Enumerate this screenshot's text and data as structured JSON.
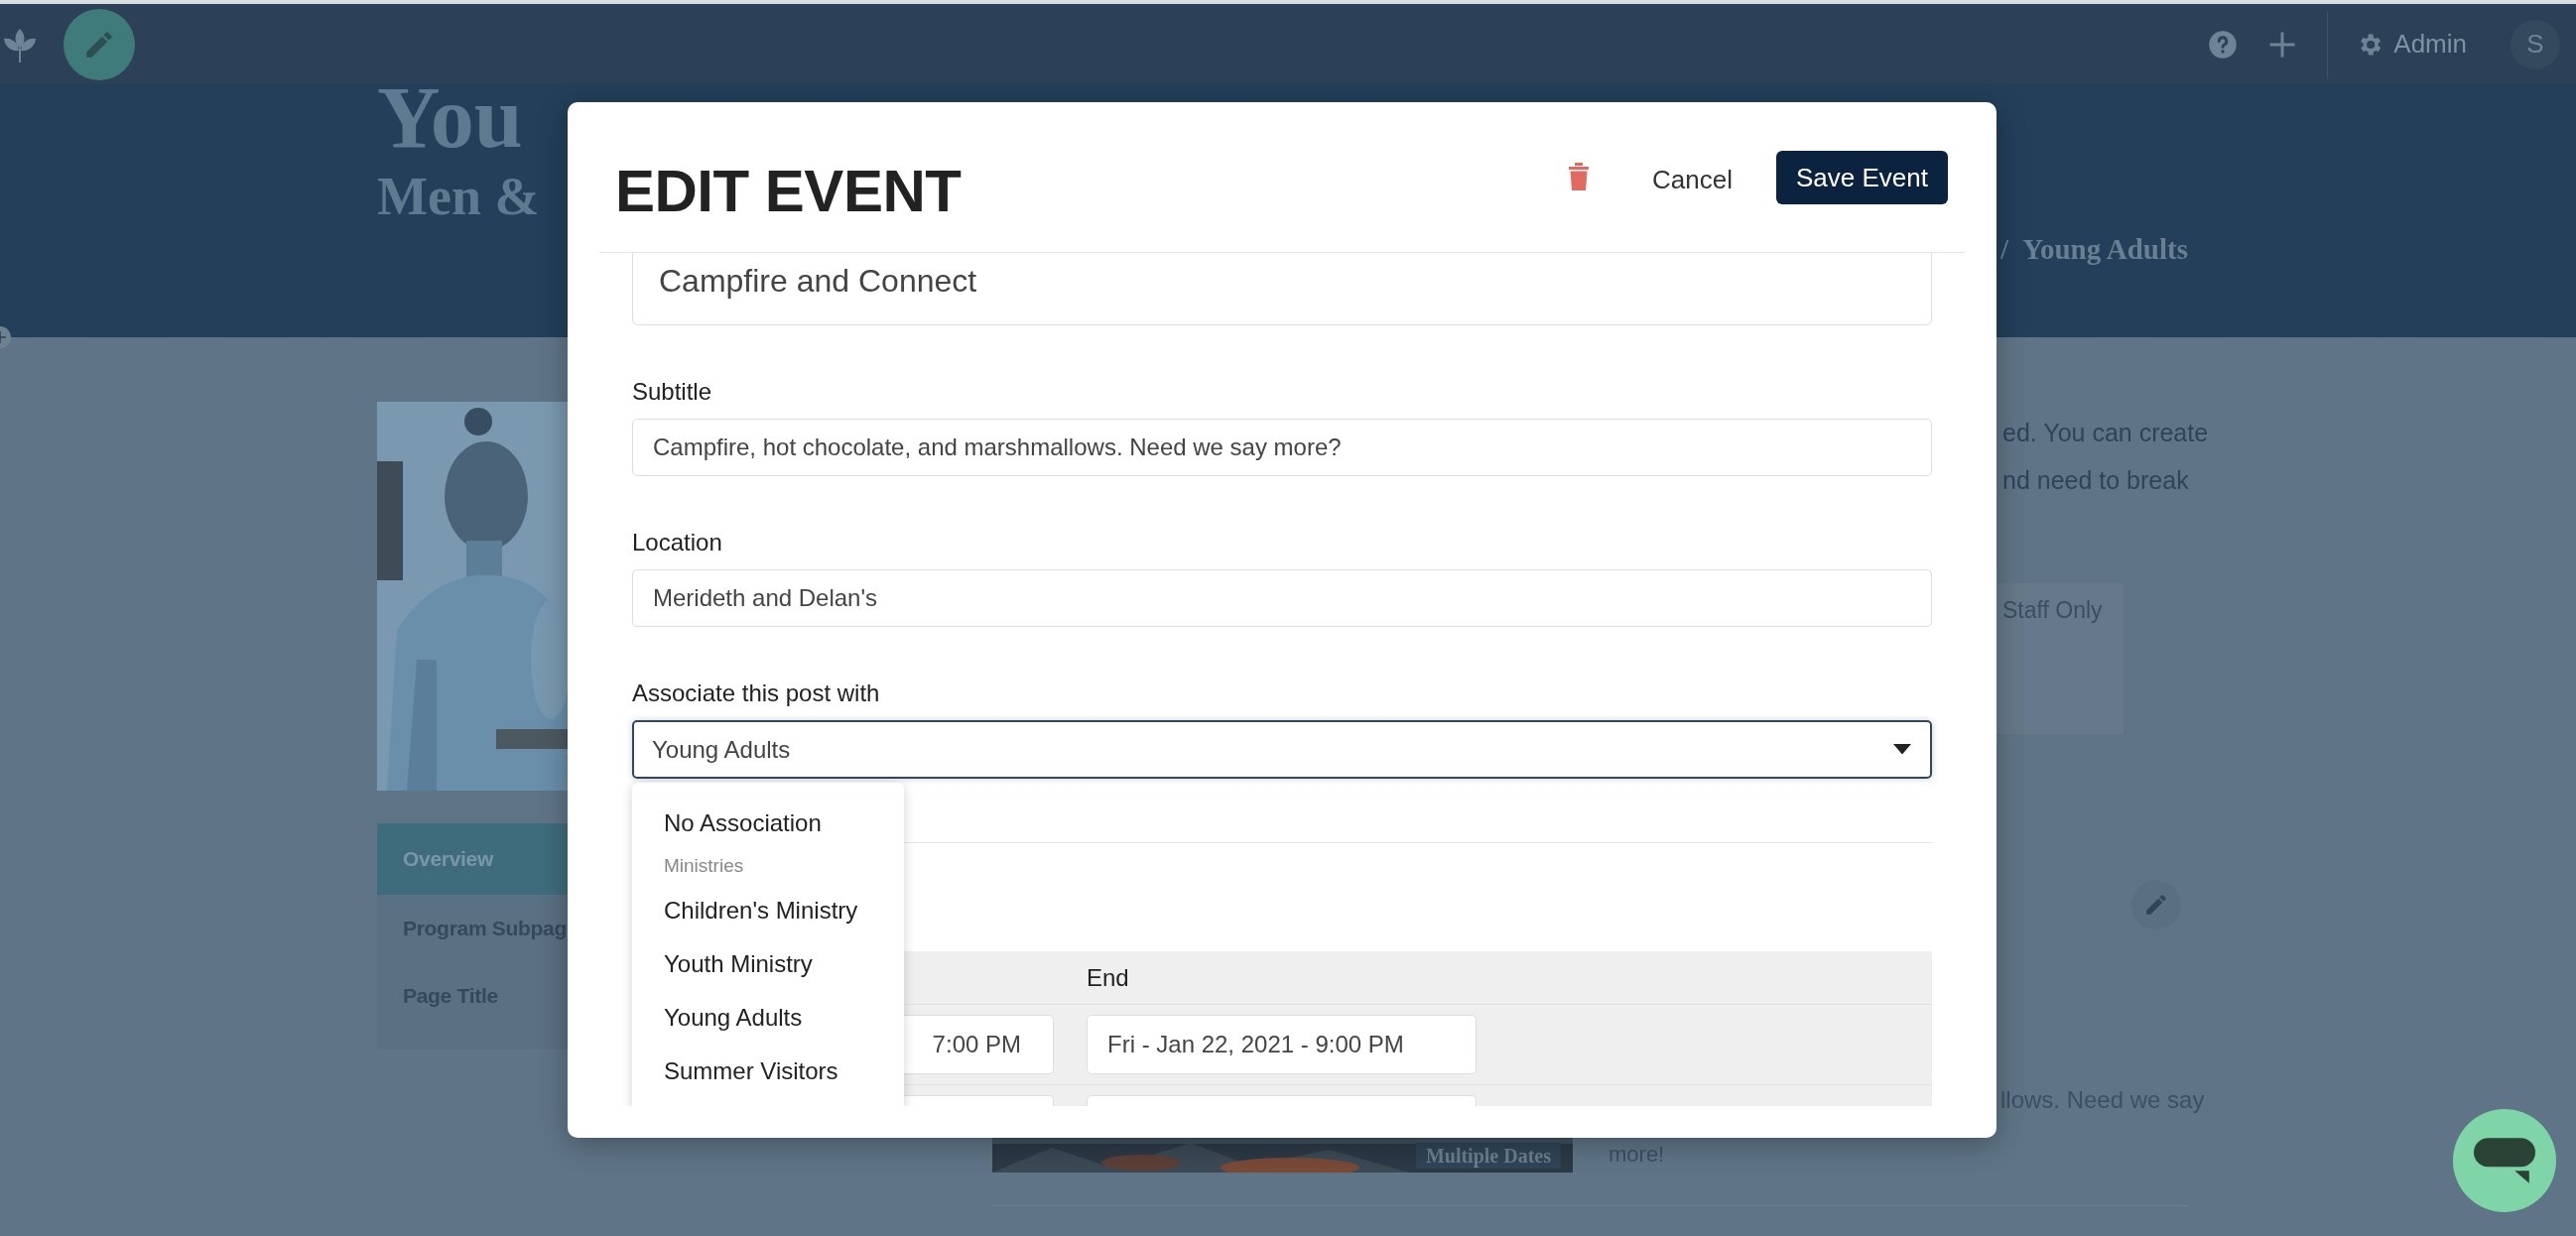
{
  "top_bar": {
    "admin_label": "Admin",
    "avatar_initial": "S"
  },
  "page_header": {
    "title": "You",
    "subtitle": "Men &",
    "breadcrumb_separator": "/",
    "breadcrumb_current": "Young Adults"
  },
  "sidebar": {
    "items": [
      {
        "label": "Overview",
        "selected": true
      },
      {
        "label": "Program Subpag",
        "selected": false
      },
      {
        "label": "Page Title",
        "selected": false
      }
    ]
  },
  "content": {
    "intro_lines": [
      "ed. You can create",
      "nd need to break"
    ],
    "visibility_label": "Staff Only",
    "event_card": {
      "badge": "Multiple Dates",
      "description_lines": [
        "llows. Need we say",
        "more!"
      ]
    }
  },
  "modal": {
    "title": "EDIT EVENT",
    "cancel_label": "Cancel",
    "save_label": "Save Event",
    "event_title": "Campfire and Connect",
    "fields": [
      {
        "label": "Subtitle",
        "value": "Campfire, hot chocolate, and marshmallows. Need we say more?"
      },
      {
        "label": "Location",
        "value": "Merideth and Delan's"
      }
    ],
    "association": {
      "label": "Associate this post with",
      "value": "Young Adults",
      "open": true,
      "options": [
        {
          "kind": "option",
          "label": "No Association"
        },
        {
          "kind": "group",
          "label": "Ministries"
        },
        {
          "kind": "option",
          "label": "Children's Ministry"
        },
        {
          "kind": "option",
          "label": "Youth Ministry"
        },
        {
          "kind": "option",
          "label": "Young Adults"
        },
        {
          "kind": "option",
          "label": "Summer Visitors"
        }
      ]
    },
    "dates": {
      "columns": [
        "End"
      ],
      "rows": [
        {
          "start": "7:00 PM",
          "end": "Fri - Jan 22, 2021 - 9:00 PM"
        },
        {}
      ]
    }
  }
}
